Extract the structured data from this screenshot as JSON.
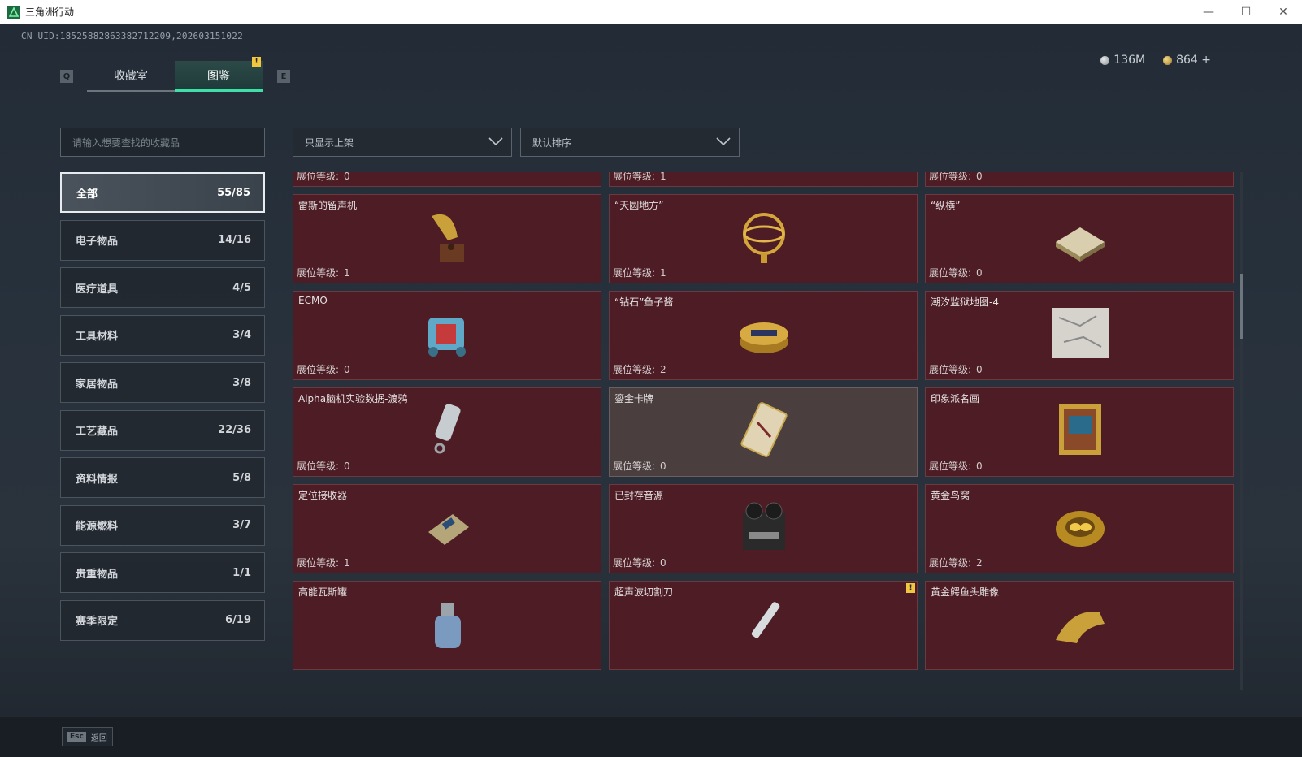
{
  "window": {
    "title": "三角洲行动",
    "minimize": "—",
    "maximize": "☐",
    "close": "✕"
  },
  "uid": "CN UID:18525882863382712209,202603151022",
  "currency": {
    "silver": "136M",
    "gold": "864 +"
  },
  "keys": {
    "prev": "Q",
    "next": "E",
    "esc": "Esc",
    "back_label": "返回"
  },
  "tabs": [
    {
      "label": "收藏室"
    },
    {
      "label": "图鉴",
      "badge": "!"
    }
  ],
  "search": {
    "placeholder": "请输入想要查找的收藏品"
  },
  "filters": {
    "shelf": "只显示上架",
    "sort": "默认排序"
  },
  "categories": [
    {
      "label": "全部",
      "count": "55/85"
    },
    {
      "label": "电子物品",
      "count": "14/16"
    },
    {
      "label": "医疗道具",
      "count": "4/5"
    },
    {
      "label": "工具材料",
      "count": "3/4"
    },
    {
      "label": "家居物品",
      "count": "3/8"
    },
    {
      "label": "工艺藏品",
      "count": "22/36"
    },
    {
      "label": "资料情报",
      "count": "5/8"
    },
    {
      "label": "能源燃料",
      "count": "3/7"
    },
    {
      "label": "贵重物品",
      "count": "1/1"
    },
    {
      "label": "赛季限定",
      "count": "6/19"
    }
  ],
  "level_label": "展位等级:",
  "items": [
    {
      "name": "",
      "level": "0",
      "icon": "terminal-icon"
    },
    {
      "name": "",
      "level": "1",
      "icon": "coffee-bag-icon"
    },
    {
      "name": "",
      "level": "0",
      "icon": "server-cylinder-icon"
    },
    {
      "name": "雷斯的留声机",
      "level": "1",
      "icon": "gramophone-icon"
    },
    {
      "name": "“天圆地方”",
      "level": "1",
      "icon": "armillary-sphere-icon"
    },
    {
      "name": "“纵横”",
      "level": "0",
      "icon": "chess-board-icon"
    },
    {
      "name": "ECMO",
      "level": "0",
      "icon": "ecmo-machine-icon"
    },
    {
      "name": "“钻石”鱼子酱",
      "level": "2",
      "icon": "caviar-tin-icon"
    },
    {
      "name": "潮汐监狱地图-4",
      "level": "0",
      "icon": "map-icon"
    },
    {
      "name": "Alpha脑机实验数据-渡鸦",
      "level": "0",
      "icon": "data-canister-icon"
    },
    {
      "name": "鎏金卡牌",
      "level": "0",
      "icon": "gilded-card-icon"
    },
    {
      "name": "印象派名画",
      "level": "0",
      "icon": "painting-icon"
    },
    {
      "name": "定位接收器",
      "level": "1",
      "icon": "receiver-icon"
    },
    {
      "name": "已封存音源",
      "level": "0",
      "icon": "tape-recorder-icon"
    },
    {
      "name": "黄金鸟窝",
      "level": "2",
      "icon": "golden-nest-icon"
    },
    {
      "name": "高能瓦斯罐",
      "level": "",
      "icon": "gas-canister-icon"
    },
    {
      "name": "超声波切割刀",
      "level": "",
      "icon": "ultrasonic-knife-icon",
      "badge": "!"
    },
    {
      "name": "黄金鳄鱼头雕像",
      "level": "",
      "icon": "gold-crocodile-head-icon"
    }
  ],
  "colors": {
    "accent": "#3fe0a8",
    "card_bg": "#4d1c24",
    "card_grey": "#4a3e3f",
    "badge": "#f1c740"
  }
}
